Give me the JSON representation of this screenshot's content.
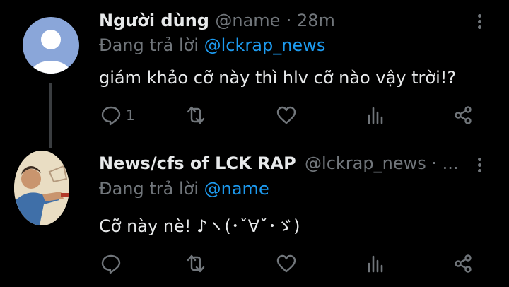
{
  "tweets": [
    {
      "display_name": "Người dùng",
      "handle": "@name",
      "time": "· 28m",
      "reply_prefix": "Đang trả lời ",
      "reply_to": "@lckrap_news",
      "text": "giám khảo cỡ này thì hlv cỡ nào vậy trời!?",
      "reply_count": "1",
      "avatar_icon": "default-user-icon"
    },
    {
      "display_name": "News/cfs of LCK RAP",
      "handle": "@lckrap_news · ...",
      "reply_prefix": "Đang trả lời ",
      "reply_to": "@name",
      "text": "Cỡ này nè! ♪ヽ(･ˇ∀ˇ･ゞ)",
      "reply_count": "",
      "avatar_icon": "illustration-avatar"
    }
  ],
  "colors": {
    "background": "#000000",
    "text": "#e7e9ea",
    "muted": "#71767b",
    "link": "#1d9bf0"
  }
}
